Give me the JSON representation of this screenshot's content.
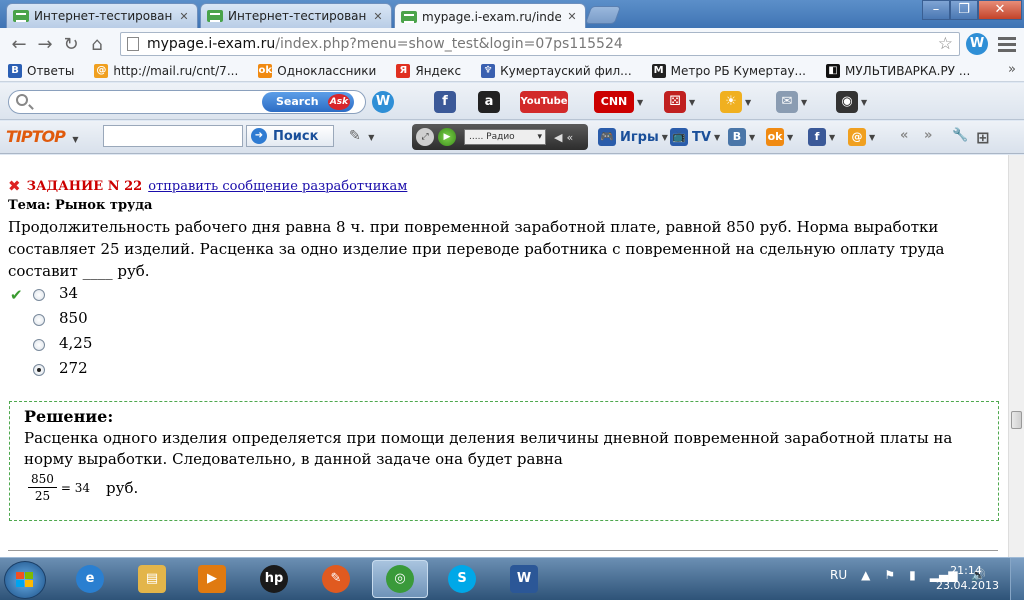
{
  "browser": {
    "tabs": [
      {
        "title": "Интернет-тестирование",
        "active": false
      },
      {
        "title": "Интернет-тестирование",
        "active": false
      },
      {
        "title": "mypage.i-exam.ru/index.p",
        "active": true
      }
    ],
    "address": {
      "domain": "mypage.i-exam.ru",
      "path": "/index.php?menu=show_test&login=07ps115524"
    },
    "bookmarks": [
      {
        "label": "Ответы",
        "icon": "b-icon",
        "color": "#2b5fb4",
        "glyph": "B"
      },
      {
        "label": "http://mail.ru/cnt/7...",
        "icon": "mail-at-icon",
        "color": "#f0a020",
        "glyph": "@"
      },
      {
        "label": "Одноклассники",
        "icon": "odnoklassniki-icon",
        "color": "#f08a12",
        "glyph": "ok"
      },
      {
        "label": "Яндекс",
        "icon": "yandex-icon",
        "color": "#e03020",
        "glyph": "Я"
      },
      {
        "label": "Кумертауский фил...",
        "icon": "emblem-icon",
        "color": "#3a60b0",
        "glyph": "♆"
      },
      {
        "label": "Метро РБ Кумертау...",
        "icon": "metro-icon",
        "color": "#222222",
        "glyph": "M"
      },
      {
        "label": "МУЛЬТИВАРКА.РУ ...",
        "icon": "multivarka-icon",
        "color": "#111111",
        "glyph": "◧"
      }
    ],
    "bookmarks_more": "»"
  },
  "toolbar_ask": {
    "search_button": "Search",
    "ask_logo": "Ask",
    "icons": [
      {
        "name": "webmoney-icon",
        "glyph": "W",
        "color": "#2f8fd6"
      },
      {
        "name": "facebook-icon",
        "glyph": "f",
        "color": "#3b5998"
      },
      {
        "name": "amazon-icon",
        "glyph": "a",
        "color": "#222222"
      },
      {
        "name": "youtube-icon",
        "glyph": "YouTube",
        "color": "#d22a2a"
      },
      {
        "name": "cnn-icon",
        "glyph": "CNN",
        "color": "#cc0000"
      },
      {
        "name": "dice-icon",
        "glyph": "⚄",
        "color": "#c02020"
      },
      {
        "name": "weather-icon",
        "glyph": "☀",
        "color": "#f0b020"
      },
      {
        "name": "mail-envelope-icon",
        "glyph": "✉",
        "color": "#8a9cb2"
      },
      {
        "name": "eye-icon",
        "glyph": "◉",
        "color": "#333333"
      }
    ]
  },
  "toolbar_tiptop": {
    "logo": "TIPTOP",
    "search_button": "Поиск",
    "radio_label": "..... Радио",
    "items": [
      {
        "name": "games-menu",
        "label": "Игры",
        "glyph": "🎮",
        "color": "#2a5caa"
      },
      {
        "name": "tv-menu",
        "label": "TV",
        "glyph": "📺",
        "color": "#2a5caa"
      },
      {
        "name": "vkontakte-icon",
        "label": "",
        "glyph": "B",
        "color": "#4a76a8"
      },
      {
        "name": "odnoklassniki-icon",
        "label": "",
        "glyph": "ok",
        "color": "#f08a12"
      },
      {
        "name": "facebook-icon",
        "label": "",
        "glyph": "f",
        "color": "#3b5998"
      },
      {
        "name": "mailru-icon",
        "label": "",
        "glyph": "@",
        "color": "#f0a020"
      }
    ]
  },
  "task": {
    "number_label": "ЗАДАНИЕ N 22",
    "link": "отправить сообщение разработчикам",
    "topic": "Тема: Рынок труда",
    "question": "Продолжительность рабочего дня равна 8 ч. при повременной заработной плате, равной 850 руб. Норма выработки составляет 25 изделий. Расценка за одно изделие при переводе работника с повременной на сдельную оплату труда составит ____ руб.",
    "options": [
      {
        "text": "34",
        "selected": false,
        "correct": true
      },
      {
        "text": "850",
        "selected": false,
        "correct": false
      },
      {
        "text": "4,25",
        "selected": false,
        "correct": false
      },
      {
        "text": "272",
        "selected": true,
        "correct": false
      }
    ],
    "solution": {
      "title": "Решение:",
      "text": "Расценка одного изделия определяется при помощи деления величины дневной повременной заработной платы на норму выработки. Следовательно, в данной задаче она будет равна",
      "numerator": "850",
      "denominator": "25",
      "equals": "= 34",
      "unit": "руб."
    }
  },
  "taskbar": {
    "apps": [
      {
        "name": "ie-icon",
        "glyph": "e",
        "color": "#2a7fd0",
        "active": false
      },
      {
        "name": "explorer-icon",
        "glyph": "▤",
        "color": "#e3b54a",
        "active": false
      },
      {
        "name": "media-player-icon",
        "glyph": "▶",
        "color": "#e07a10",
        "active": false
      },
      {
        "name": "hp-icon",
        "glyph": "hp",
        "color": "#1a1a1a",
        "active": false
      },
      {
        "name": "paint-icon",
        "glyph": "✎",
        "color": "#e05a20",
        "active": false
      },
      {
        "name": "chrome-icon",
        "glyph": "◎",
        "color": "#3a9a3a",
        "active": true
      },
      {
        "name": "skype-icon",
        "glyph": "S",
        "color": "#00a8e8",
        "active": false
      },
      {
        "name": "word-icon",
        "glyph": "W",
        "color": "#2b5797",
        "active": false
      }
    ],
    "language": "RU",
    "time": "21:14",
    "date": "23.04.2013"
  }
}
